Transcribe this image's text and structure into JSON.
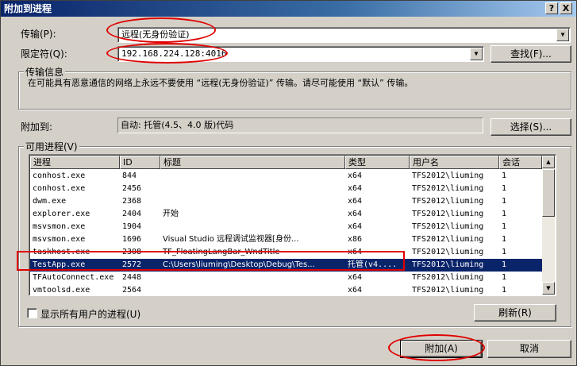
{
  "window": {
    "title": "附加到进程",
    "help_button": "?",
    "close_button": "X"
  },
  "transport": {
    "label": "传输(P):",
    "value": "远程(无身份验证)"
  },
  "qualifier": {
    "label": "限定符(Q):",
    "value": "192.168.224.128:4016",
    "find_button": "查找(F)..."
  },
  "transport_info": {
    "title": "传输信息",
    "text": "在可能具有恶意通信的网络上永远不要使用 “远程(无身份验证)” 传输。请尽可能使用 “默认” 传输。"
  },
  "attach_to": {
    "label": "附加到:",
    "value": "自动: 托管(4.5、4.0 版)代码",
    "select_button": "选择(S)..."
  },
  "available_processes": {
    "title": "可用进程(V)",
    "columns": [
      "进程",
      "ID",
      "标题",
      "类型",
      "用户名",
      "会话"
    ],
    "rows": [
      {
        "process": "conhost.exe",
        "id": "844",
        "title": "",
        "type": "x64",
        "user": "TFS2012\\liuming",
        "session": "1"
      },
      {
        "process": "conhost.exe",
        "id": "2456",
        "title": "",
        "type": "x64",
        "user": "TFS2012\\liuming",
        "session": "1"
      },
      {
        "process": "dwm.exe",
        "id": "2368",
        "title": "",
        "type": "x64",
        "user": "TFS2012\\liuming",
        "session": "1"
      },
      {
        "process": "explorer.exe",
        "id": "2404",
        "title": "开始",
        "type": "x64",
        "user": "TFS2012\\liuming",
        "session": "1"
      },
      {
        "process": "msvsmon.exe",
        "id": "1904",
        "title": "",
        "type": "x64",
        "user": "TFS2012\\liuming",
        "session": "1"
      },
      {
        "process": "msvsmon.exe",
        "id": "1696",
        "title": "Visual Studio 远程调试监视器[身份...",
        "type": "x86",
        "user": "TFS2012\\liuming",
        "session": "1"
      },
      {
        "process": "taskhost.exe",
        "id": "2308",
        "title": "TF_FloatingLangBar_WndTitle",
        "type": "x64",
        "user": "TFS2012\\liuming",
        "session": "1"
      },
      {
        "process": "TestApp.exe",
        "id": "2572",
        "title": "C:\\Users\\liuming\\Desktop\\Debug\\Tes...",
        "type": "托管(v4....",
        "user": "TFS2012\\liuming",
        "session": "1"
      },
      {
        "process": "TFAutoConnect.exe",
        "id": "2448",
        "title": "",
        "type": "x64",
        "user": "TFS2012\\liuming",
        "session": "1"
      },
      {
        "process": "vmtoolsd.exe",
        "id": "2564",
        "title": "",
        "type": "x64",
        "user": "TFS2012\\liuming",
        "session": "1"
      }
    ],
    "selected_row": 7,
    "show_all_users_label": "显示所有用户的进程(U)",
    "show_all_users_checked": false,
    "refresh_button": "刷新(R)"
  },
  "footer": {
    "attach_button": "附加(A)",
    "cancel_button": "取消"
  },
  "colors": {
    "dialog_bg": "#d4d0c8",
    "title_bar": "#0a246a",
    "selection": "#0a246a",
    "annotation_red": "#e00000"
  }
}
